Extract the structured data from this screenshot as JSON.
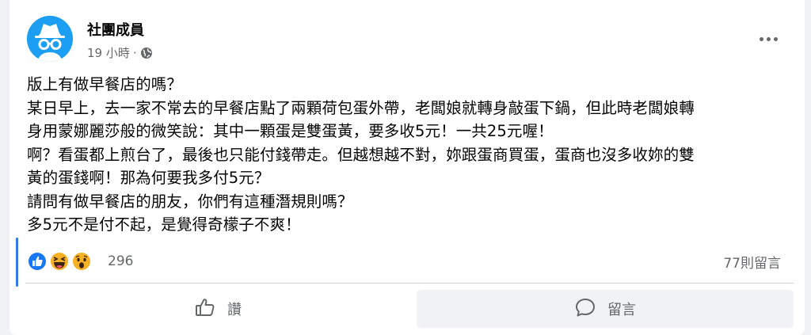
{
  "post": {
    "author": "社團成員",
    "time": "19 小時",
    "separator": "·",
    "privacy_icon": "globe-icon",
    "more_icon": "more-horizontal-icon",
    "lines": [
      "版上有做早餐店的嗎？",
      "某日早上，去一家不常去的早餐店點了兩顆荷包蛋外帶，老闆娘就轉身敲蛋下鍋，但此時老闆娘轉",
      "身用蒙娜麗莎般的微笑說：其中一顆蛋是雙蛋黃，要多收5元！一共25元喔！",
      "啊？看蛋都上煎台了，最後也只能付錢帶走。但越想越不對，妳跟蛋商買蛋，蛋商也沒多收妳的雙",
      "黃的蛋錢啊！那為何要我多付5元？",
      "請問有做早餐店的朋友，你們有這種潛規則嗎？",
      "多5元不是付不起，是覺得奇檬子不爽！"
    ]
  },
  "engagement": {
    "reaction_icons": [
      "like-reaction-icon",
      "haha-reaction-icon",
      "wow-reaction-icon"
    ],
    "reaction_count": "296",
    "comment_count": "77則留言"
  },
  "actions": {
    "like_label": "讚",
    "comment_label": "留言"
  },
  "colors": {
    "avatar_bg": "#1c9ff2",
    "like_blue": "#1877f2",
    "reaction_yellow": "#f7b125",
    "secondary_text": "#65676b"
  }
}
